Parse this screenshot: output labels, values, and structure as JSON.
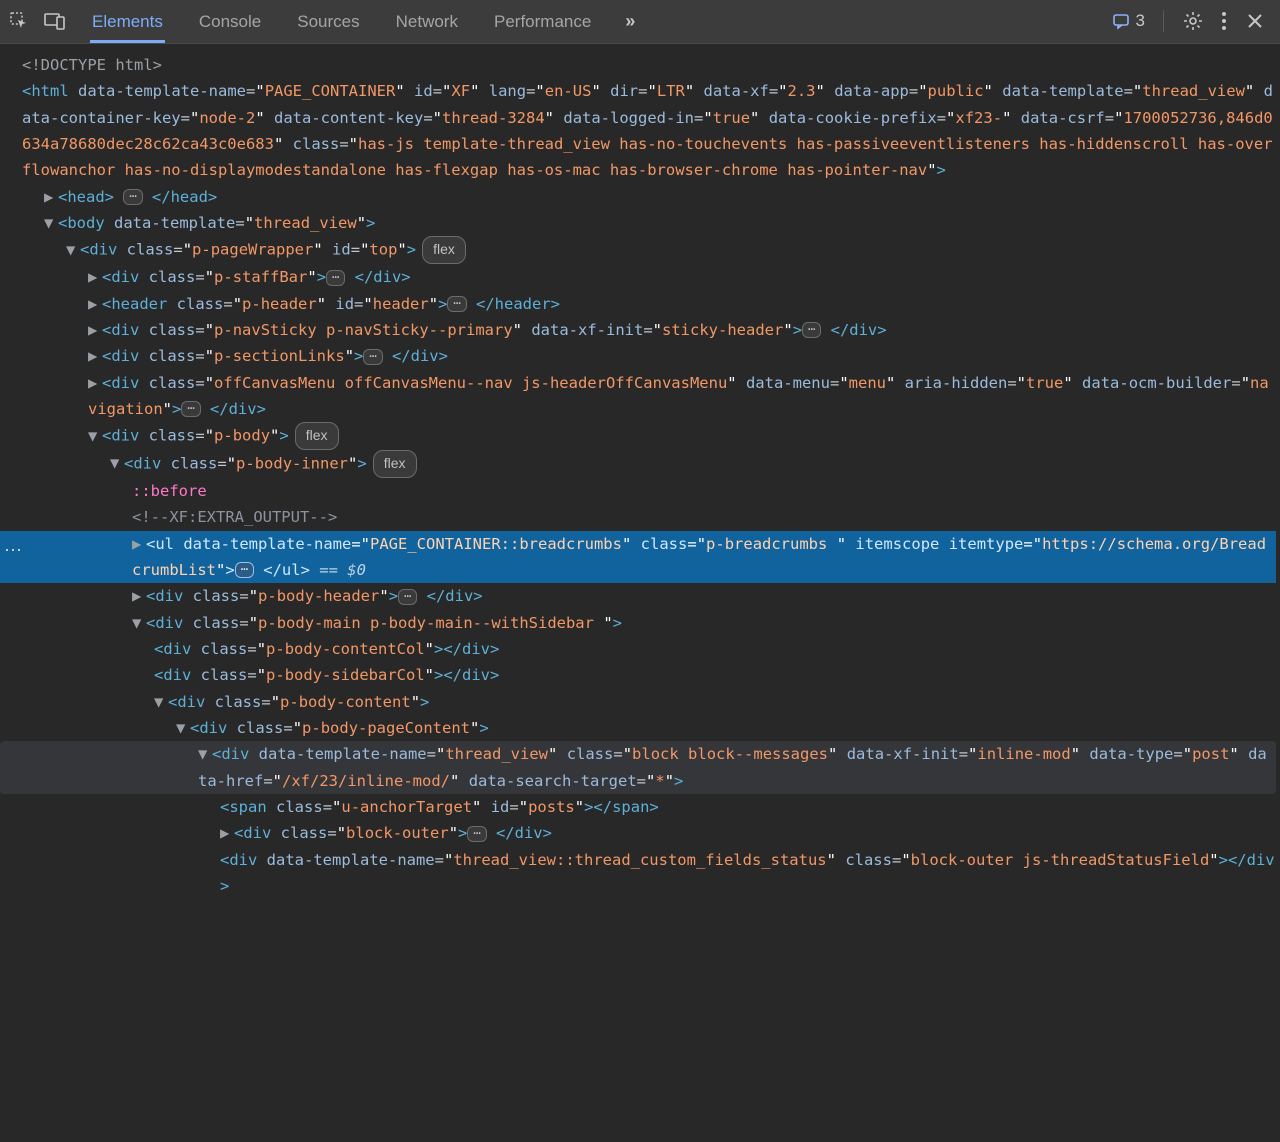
{
  "toolbar": {
    "tabs": [
      "Elements",
      "Console",
      "Sources",
      "Network",
      "Performance"
    ],
    "active_tab": "Elements",
    "more_label": "»",
    "messages_count": "3"
  },
  "dom": {
    "doctype": "<!DOCTYPE html>",
    "html_open": {
      "tag": "html",
      "attrs": [
        {
          "n": "data-template-name",
          "v": "PAGE_CONTAINER"
        },
        {
          "n": "id",
          "v": "XF"
        },
        {
          "n": "lang",
          "v": "en-US"
        },
        {
          "n": "dir",
          "v": "LTR"
        },
        {
          "n": "data-xf",
          "v": "2.3"
        },
        {
          "n": "data-app",
          "v": "public"
        },
        {
          "n": "data-template",
          "v": "thread_view"
        },
        {
          "n": "data-container-key",
          "v": "node-2"
        },
        {
          "n": "data-content-key",
          "v": "thread-3284"
        },
        {
          "n": "data-logged-in",
          "v": "true"
        },
        {
          "n": "data-cookie-prefix",
          "v": "xf23-"
        },
        {
          "n": "data-csrf",
          "v": "1700052736,846d0634a78680dec28c62ca43c0e683"
        },
        {
          "n": "class",
          "v": "has-js template-thread_view has-no-touchevents has-passiveeventlisteners has-hiddenscroll has-overflowanchor has-no-displaymodestandalone has-flexgap has-os-mac has-browser-chrome has-pointer-nav"
        }
      ]
    },
    "head": {
      "tag": "head"
    },
    "body_open": {
      "tag": "body",
      "attrs": [
        {
          "n": "data-template",
          "v": "thread_view"
        }
      ]
    },
    "pagewrapper": {
      "tag": "div",
      "attrs": [
        {
          "n": "class",
          "v": "p-pageWrapper"
        },
        {
          "n": "id",
          "v": "top"
        }
      ],
      "pill": "flex"
    },
    "staffbar": {
      "tag": "div",
      "attrs": [
        {
          "n": "class",
          "v": "p-staffBar"
        }
      ]
    },
    "header": {
      "tag": "header",
      "attrs": [
        {
          "n": "class",
          "v": "p-header"
        },
        {
          "n": "id",
          "v": "header"
        }
      ]
    },
    "navsticky": {
      "tag": "div",
      "attrs": [
        {
          "n": "class",
          "v": "p-navSticky p-navSticky--primary"
        },
        {
          "n": "data-xf-init",
          "v": "sticky-header"
        }
      ]
    },
    "sectionlinks": {
      "tag": "div",
      "attrs": [
        {
          "n": "class",
          "v": "p-sectionLinks"
        }
      ]
    },
    "offcanvas": {
      "tag": "div",
      "attrs": [
        {
          "n": "class",
          "v": "offCanvasMenu offCanvasMenu--nav js-headerOffCanvasMenu"
        },
        {
          "n": "data-menu",
          "v": "menu"
        },
        {
          "n": "aria-hidden",
          "v": "true"
        },
        {
          "n": "data-ocm-builder",
          "v": "navigation"
        }
      ]
    },
    "pbody": {
      "tag": "div",
      "attrs": [
        {
          "n": "class",
          "v": "p-body"
        }
      ],
      "pill": "flex"
    },
    "pbodyinner": {
      "tag": "div",
      "attrs": [
        {
          "n": "class",
          "v": "p-body-inner"
        }
      ],
      "pill": "flex"
    },
    "pseudo_before": "::before",
    "xf_comment": "<!--XF:EXTRA_OUTPUT-->",
    "breadcrumbs": {
      "tag": "ul",
      "attrs": [
        {
          "n": "data-template-name",
          "v": "PAGE_CONTAINER::breadcrumbs"
        },
        {
          "n": "class",
          "v": "p-breadcrumbs "
        }
      ],
      "flags": "itemscope",
      "trail_attr": {
        "n": "itemtype",
        "v": "https://schema.org/BreadcrumbList"
      },
      "selected_marker": "== $0"
    },
    "pbodyheader": {
      "tag": "div",
      "attrs": [
        {
          "n": "class",
          "v": "p-body-header"
        }
      ]
    },
    "pbodymain": {
      "tag": "div",
      "attrs": [
        {
          "n": "class",
          "v": "p-body-main p-body-main--withSidebar "
        }
      ]
    },
    "contentcol": {
      "tag": "div",
      "attrs": [
        {
          "n": "class",
          "v": "p-body-contentCol"
        }
      ]
    },
    "sidebarcol": {
      "tag": "div",
      "attrs": [
        {
          "n": "class",
          "v": "p-body-sidebarCol"
        }
      ]
    },
    "bodycontent": {
      "tag": "div",
      "attrs": [
        {
          "n": "class",
          "v": "p-body-content"
        }
      ]
    },
    "pagecontent": {
      "tag": "div",
      "attrs": [
        {
          "n": "class",
          "v": "p-body-pageContent"
        }
      ]
    },
    "threadview": {
      "tag": "div",
      "attrs": [
        {
          "n": "data-template-name",
          "v": "thread_view"
        },
        {
          "n": "class",
          "v": "block block--messages"
        },
        {
          "n": "data-xf-init",
          "v": "inline-mod"
        },
        {
          "n": "data-type",
          "v": "post"
        },
        {
          "n": "data-href",
          "v": "/xf/23/inline-mod/"
        },
        {
          "n": "data-search-target",
          "v": "*"
        }
      ]
    },
    "anchorspan": {
      "tag": "span",
      "attrs": [
        {
          "n": "class",
          "v": "u-anchorTarget"
        },
        {
          "n": "id",
          "v": "posts"
        }
      ]
    },
    "blockouter": {
      "tag": "div",
      "attrs": [
        {
          "n": "class",
          "v": "block-outer"
        }
      ]
    },
    "statusfields": {
      "tag": "div",
      "attrs": [
        {
          "n": "data-template-name",
          "v": "thread_view::thread_custom_fields_status"
        },
        {
          "n": "class",
          "v": "block-outer js-threadStatusField"
        }
      ]
    }
  }
}
